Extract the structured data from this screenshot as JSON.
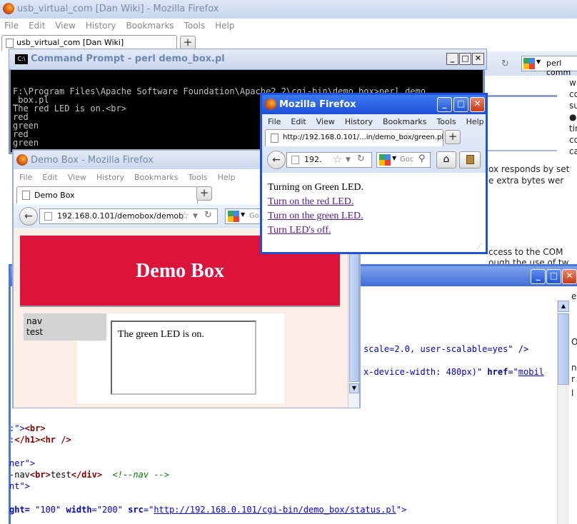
{
  "main_window": {
    "title": "usb_virtual_com [Dan Wiki] - Mozilla Firefox",
    "menu": [
      "File",
      "Edit",
      "View",
      "History",
      "Bookmarks",
      "Tools",
      "Help"
    ],
    "tab_label": "usb_virtual_com [Dan Wiki]",
    "search_placeholder": "perl comm"
  },
  "wiki_right": {
    "lines": [
      "w",
      "co",
      "su",
      "tin",
      "co",
      "ca"
    ],
    "text1": "ox responds by set",
    "text2": "e extra bytes wer",
    "text3": "ccess to the COM",
    "text4": "ough the use of tw"
  },
  "cmd": {
    "title": "Command Prompt - perl demo_box.pl",
    "lines": [
      "F:\\Program Files\\Apache Software Foundation\\Apache2.2\\cgi-bin\\demo_box>perl demo",
      "_box.pl",
      "The red LED is on.<br>",
      "red",
      "green",
      "red",
      "green"
    ]
  },
  "popup": {
    "title": "Mozilla Firefox",
    "menu": [
      "File",
      "Edit",
      "View",
      "History",
      "Bookmarks",
      "Tools",
      "Help"
    ],
    "tab_url": "http://192.168.0.101/...in/demo_box/green.pl",
    "url": "192.",
    "search": "Goc",
    "status": "Turning on Green LED.",
    "links": [
      "Turn on the red LED.",
      "Turn on the green LED.",
      "Turn LED's off."
    ]
  },
  "demo": {
    "title": "Demo Box - Mozilla Firefox",
    "menu": [
      "File",
      "Edit",
      "View",
      "History",
      "Bookmarks",
      "Tools",
      "Help"
    ],
    "tab_label": "Demo Box",
    "url": "192.168.0.101/demobox/demob",
    "search": "Go",
    "heading": "Demo Box",
    "nav1": "nav",
    "nav2": "test",
    "content": "The green LED is on."
  },
  "editor": {
    "right_letters": [
      "e",
      "O",
      "n",
      "r",
      "l"
    ],
    "line1_a": "scale=2.0, user-scalable=yes",
    "line1_b": "\" />",
    "line2_a": "x-device-width: 480px)",
    "line2_b": "\" ",
    "line2_c": "href",
    "line2_d": "=\"",
    "line2_e": "mobil",
    "l3_a": ":\">",
    "l3_b": "<br>",
    "l4_a": ":",
    "l4_b": "</h1><hr />",
    "l5": "ner\">",
    "l6_a": "-nav",
    "l6_b": "<br>",
    "l6_c": "test",
    "l6_d": "</div>",
    "l6_e": "<!--nav -->",
    "l7": "nt\">",
    "l8_a": "ght=",
    "l8_b": " \"100\" ",
    "l8_c": "width",
    "l8_d": "=\"200\" ",
    "l8_e": "src",
    "l8_f": "=\"",
    "l8_g": "http://192.168.0.101/cgi-bin/demo_box/status.pl",
    "l8_h": "\">"
  }
}
